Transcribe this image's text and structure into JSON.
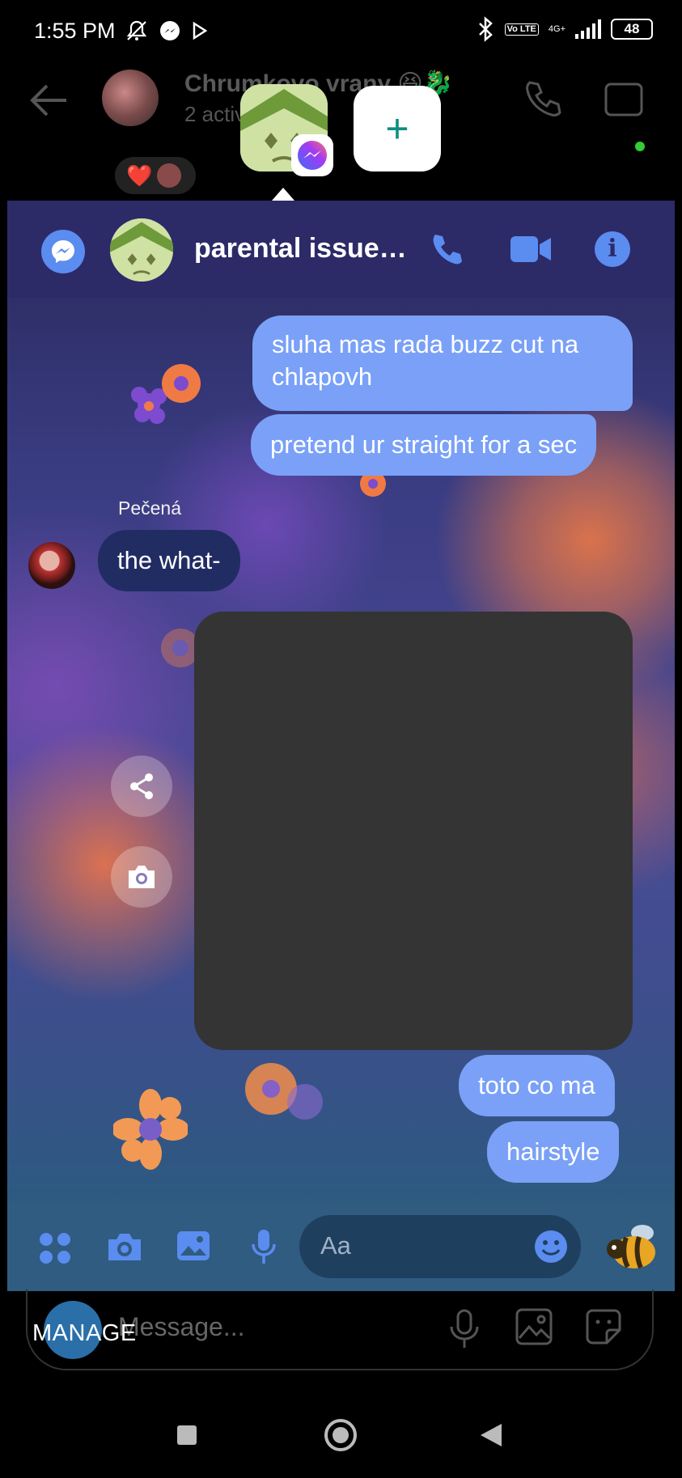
{
  "status_bar": {
    "time": "1:55 PM",
    "battery": "48",
    "network": "4G+",
    "volte": "Vo LTE",
    "icons": [
      "mute-bell-icon",
      "messenger-icon",
      "play-icon",
      "bluetooth-icon",
      "signal-icon",
      "battery-icon"
    ]
  },
  "background_chat": {
    "title": "Chrumkovo vrany 😆🐉",
    "subtitle": "2 active",
    "reaction": "❤️",
    "composer_placeholder": "Message..."
  },
  "bubble_bar": {
    "add_label": "+"
  },
  "chat": {
    "title": "parental issues…",
    "messages_out_top": [
      {
        "text": "sluha mas rada buzz cut na chlapovh"
      },
      {
        "text": "pretend ur straight for a sec"
      }
    ],
    "incoming": {
      "sender": "Pečená",
      "text": "the what-"
    },
    "messages_out_bottom": [
      {
        "text": "toto co ma"
      },
      {
        "text": "hairstyle"
      }
    ],
    "composer": {
      "placeholder": "Aa"
    }
  },
  "manage_label": "MANAGE",
  "colors": {
    "accent": "#5b8cf0",
    "bubble_out": "#7aa1f7",
    "bubble_in": "#212c63",
    "header": "#2d2a68",
    "composer": "#2f5c80"
  }
}
